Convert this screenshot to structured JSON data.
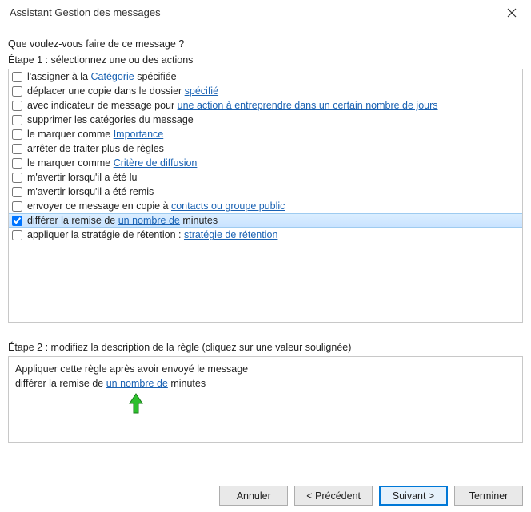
{
  "window": {
    "title": "Assistant Gestion des messages"
  },
  "prompt": "Que voulez-vous faire de ce message ?",
  "step1_label": "Étape 1 : sélectionnez une ou des actions",
  "actions": [
    {
      "checked": false,
      "pre": "l'assigner à la ",
      "link": "Catégorie",
      "post": " spécifiée"
    },
    {
      "checked": false,
      "pre": "déplacer une copie dans le dossier ",
      "link": "spécifié",
      "post": ""
    },
    {
      "checked": false,
      "pre": "avec indicateur de message pour ",
      "link": "une action à entreprendre dans un certain nombre de jours",
      "post": ""
    },
    {
      "checked": false,
      "pre": "supprimer les catégories du message",
      "link": "",
      "post": ""
    },
    {
      "checked": false,
      "pre": "le marquer comme ",
      "link": "Importance",
      "post": ""
    },
    {
      "checked": false,
      "pre": "arrêter de traiter plus de règles",
      "link": "",
      "post": ""
    },
    {
      "checked": false,
      "pre": "le marquer comme ",
      "link": "Critère de diffusion",
      "post": ""
    },
    {
      "checked": false,
      "pre": "m'avertir lorsqu'il a été lu",
      "link": "",
      "post": ""
    },
    {
      "checked": false,
      "pre": "m'avertir lorsqu'il a été remis",
      "link": "",
      "post": ""
    },
    {
      "checked": false,
      "pre": "envoyer ce message en copie à ",
      "link": "contacts ou groupe public",
      "post": ""
    },
    {
      "checked": true,
      "pre": "différer la remise de ",
      "link": "un nombre de",
      "post": " minutes",
      "selected": true
    },
    {
      "checked": false,
      "pre": "appliquer la stratégie de rétention : ",
      "link": "stratégie de rétention",
      "post": ""
    }
  ],
  "step2_label": "Étape 2 : modifiez la description de la règle (cliquez sur une valeur soulignée)",
  "description": {
    "line1": "Appliquer cette règle après avoir envoyé le message",
    "line2_pre": "différer la remise de ",
    "line2_link": "un nombre de",
    "line2_post": " minutes"
  },
  "buttons": {
    "cancel": "Annuler",
    "prev": "< Précédent",
    "next": "Suivant >",
    "finish": "Terminer"
  }
}
